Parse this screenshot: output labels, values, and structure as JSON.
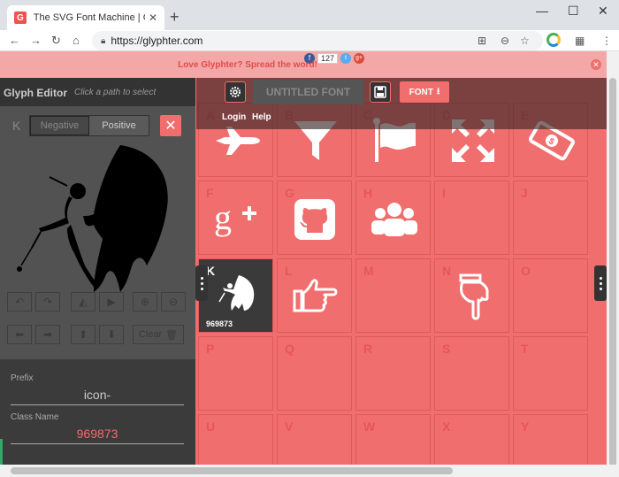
{
  "browser": {
    "tab_title": "The SVG Font Machine | Glyphter",
    "tab_favicon": "G",
    "url": "https://glyphter.com",
    "lock_icon": "lock-icon"
  },
  "banner": {
    "text": "Love Glyphter? Spread the word!",
    "fb_count": "127"
  },
  "header": {
    "font_name_placeholder": "UNTITLED FONT",
    "font_button_label": "FONT",
    "login": "Login",
    "help": "Help"
  },
  "editor": {
    "title": "Glyph Editor",
    "hint": "Click a path to select",
    "glyph_letter": "K",
    "toggle_negative": "Negative",
    "toggle_positive": "Positive",
    "clear_label": "Clear",
    "prefix_label": "Prefix",
    "prefix_value": "icon-",
    "classname_label": "Class Name",
    "classname_value": "969873"
  },
  "grid": {
    "cells": [
      {
        "letter": "A",
        "icon": "fighter-jet-icon"
      },
      {
        "letter": "B",
        "icon": "filter-icon"
      },
      {
        "letter": "C",
        "icon": "flag-icon"
      },
      {
        "letter": "D",
        "icon": "expand-icon"
      },
      {
        "letter": "E",
        "icon": "money-icon"
      },
      {
        "letter": "F",
        "icon": "google-plus-icon"
      },
      {
        "letter": "G",
        "icon": "github-icon"
      },
      {
        "letter": "H",
        "icon": "users-icon"
      },
      {
        "letter": "I",
        "icon": ""
      },
      {
        "letter": "J",
        "icon": ""
      },
      {
        "letter": "K",
        "icon": "fairy-icon",
        "code": "969873",
        "selected": true
      },
      {
        "letter": "L",
        "icon": "hand-pointer-right-icon"
      },
      {
        "letter": "M",
        "icon": ""
      },
      {
        "letter": "N",
        "icon": "hand-pointer-down-icon"
      },
      {
        "letter": "O",
        "icon": ""
      },
      {
        "letter": "P",
        "icon": ""
      },
      {
        "letter": "Q",
        "icon": ""
      },
      {
        "letter": "R",
        "icon": ""
      },
      {
        "letter": "S",
        "icon": ""
      },
      {
        "letter": "T",
        "icon": ""
      },
      {
        "letter": "U",
        "icon": ""
      },
      {
        "letter": "V",
        "icon": ""
      },
      {
        "letter": "W",
        "icon": ""
      },
      {
        "letter": "X",
        "icon": ""
      },
      {
        "letter": "Y",
        "icon": ""
      }
    ]
  },
  "colors": {
    "accent": "#f06e6e",
    "panel": "#3b3b3b",
    "selected_cell": "#3a3a3a"
  }
}
